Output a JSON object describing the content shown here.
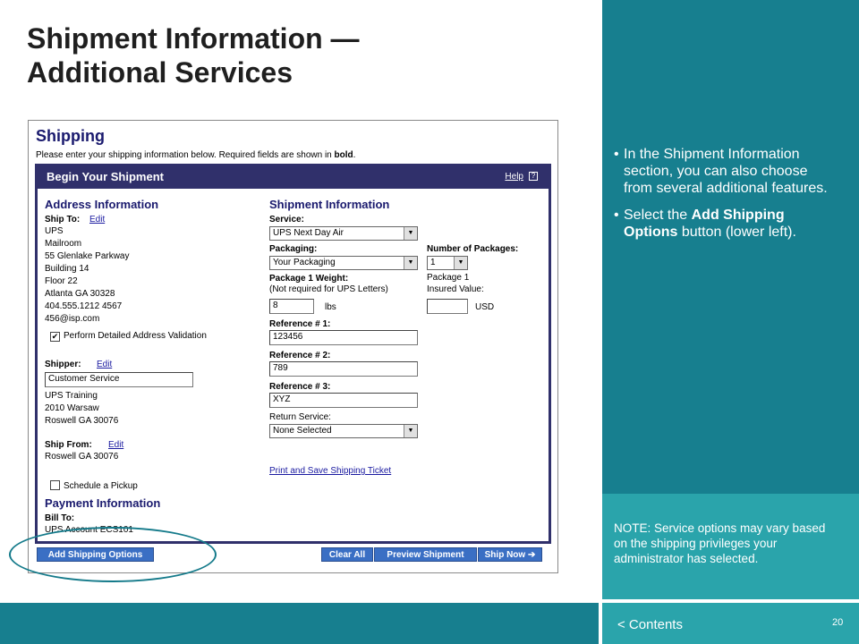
{
  "slide": {
    "title_line1": "Shipment Information —",
    "title_line2": "Additional Services",
    "bullet1": "In the Shipment Information section, you can also choose from several additional features.",
    "bullet2_pre": "Select the ",
    "bullet2_bold": "Add Shipping Options",
    "bullet2_post": " button (lower left).",
    "note": "NOTE: Service options may vary based on the shipping privileges your administrator has selected.",
    "contents_link": "< Contents",
    "page_number": "20"
  },
  "screenshot": {
    "heading": "Shipping",
    "intro_pre": "Please enter your shipping information below.  Required fields are shown in ",
    "intro_bold": "bold",
    "intro_post": ".",
    "panel_title": "Begin Your Shipment",
    "help_label": "Help",
    "help_icon": "?",
    "address": {
      "title": "Address Information",
      "ship_to_label": "Ship To:",
      "edit_label": "Edit",
      "ship_to_lines": [
        "UPS",
        "Mailroom",
        "55 Glenlake Parkway",
        "Building 14",
        "Floor 22",
        "Atlanta GA 30328",
        "404.555.1212 4567",
        "456@isp.com"
      ],
      "validation_label": "Perform Detailed Address Validation",
      "validation_checked": "✔",
      "shipper_label": "Shipper:",
      "shipper_value": "Customer Service",
      "shipper_lines": [
        "UPS Training",
        "2010 Warsaw",
        "Roswell GA 30076"
      ],
      "ship_from_label": "Ship From:",
      "ship_from_lines": [
        "Roswell GA 30076"
      ],
      "pickup_label": "Schedule a Pickup"
    },
    "payment": {
      "title": "Payment Information",
      "bill_to_label": "Bill To:",
      "bill_to_value": "UPS Account ECS101"
    },
    "shipment": {
      "title": "Shipment Information",
      "service_label": "Service:",
      "service_value": "UPS Next Day Air",
      "packaging_label": "Packaging:",
      "packaging_value": "Your Packaging",
      "num_packages_label": "Number of Packages:",
      "num_packages_value": "1",
      "weight_label": "Package 1 Weight:",
      "weight_note": "(Not required for UPS Letters)",
      "weight_value": "8",
      "weight_unit": "lbs",
      "package1_label": "Package 1",
      "insured_label": "Insured Value:",
      "insured_value": "",
      "insured_unit": "USD",
      "ref1_label": "Reference # 1:",
      "ref1_value": "123456",
      "ref2_label": "Reference # 2:",
      "ref2_value": "789",
      "ref3_label": "Reference # 3:",
      "ref3_value": "XYZ",
      "return_label": "Return Service:",
      "return_value": "None Selected",
      "print_link": "Print and Save Shipping Ticket"
    },
    "buttons": {
      "add_options": "Add Shipping Options",
      "clear_all": "Clear All",
      "preview": "Preview Shipment",
      "ship_now": "Ship Now ➔"
    }
  },
  "colors": {
    "panel_teal": "#177f8f",
    "note_teal": "#2aa4ab",
    "header_navy": "#30306b",
    "button_blue": "#3a6fc4",
    "highlight_ring": "#147a8a"
  }
}
